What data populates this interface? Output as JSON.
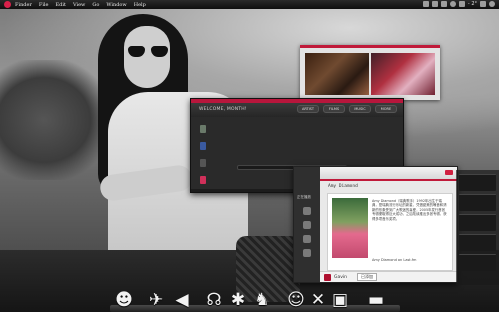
{
  "menubar": {
    "items": [
      "Finder",
      "File",
      "Edit",
      "View",
      "Go",
      "Window",
      "Help"
    ],
    "clock": "- 2°"
  },
  "app_window": {
    "title": "WELCOME, MONTH!",
    "tabs": [
      "ARTIST",
      "FILMS",
      "MUSIC",
      "MORE"
    ],
    "search_placeholder": "search",
    "sidebar_icon_colors": [
      "#6a7a6a",
      "#3a5aa0",
      "#555555",
      "#d0305a"
    ]
  },
  "chat_window": {
    "side_label": "正在播放",
    "contact_name": "Amy Diamond",
    "bio": "Amy Diamond（瑞典歌手）1992年出生于瑞典，是瑞典流行乐坛的新星，凭借甜美的嗓音和清新的形象受到广大歌迷的喜爱，2005年发行首张专辑便取得巨大成功，之后陆续推出多张专辑，获得多项音乐奖项。",
    "footer_line": "Amy Diamond on Last.fm",
    "footer_name": "Gavin",
    "footer_button": "已添加",
    "accent_color": "#c01a3a"
  },
  "dock": {
    "icons": [
      {
        "name": "robot-icon",
        "glyph": "☻"
      },
      {
        "name": "bird-icon",
        "glyph": "✈"
      },
      {
        "name": "paper-plane-icon",
        "glyph": "◀"
      },
      {
        "name": "headphones-icon",
        "glyph": "☊"
      },
      {
        "name": "gear-icon",
        "glyph": "✱"
      },
      {
        "name": "fox-icon",
        "glyph": "♞"
      },
      {
        "name": "cat-icon",
        "glyph": "☺"
      },
      {
        "name": "x-icon",
        "glyph": "✕"
      },
      {
        "name": "photo-icon",
        "glyph": "▣"
      },
      {
        "name": "folder-icon",
        "glyph": "▬"
      }
    ]
  }
}
